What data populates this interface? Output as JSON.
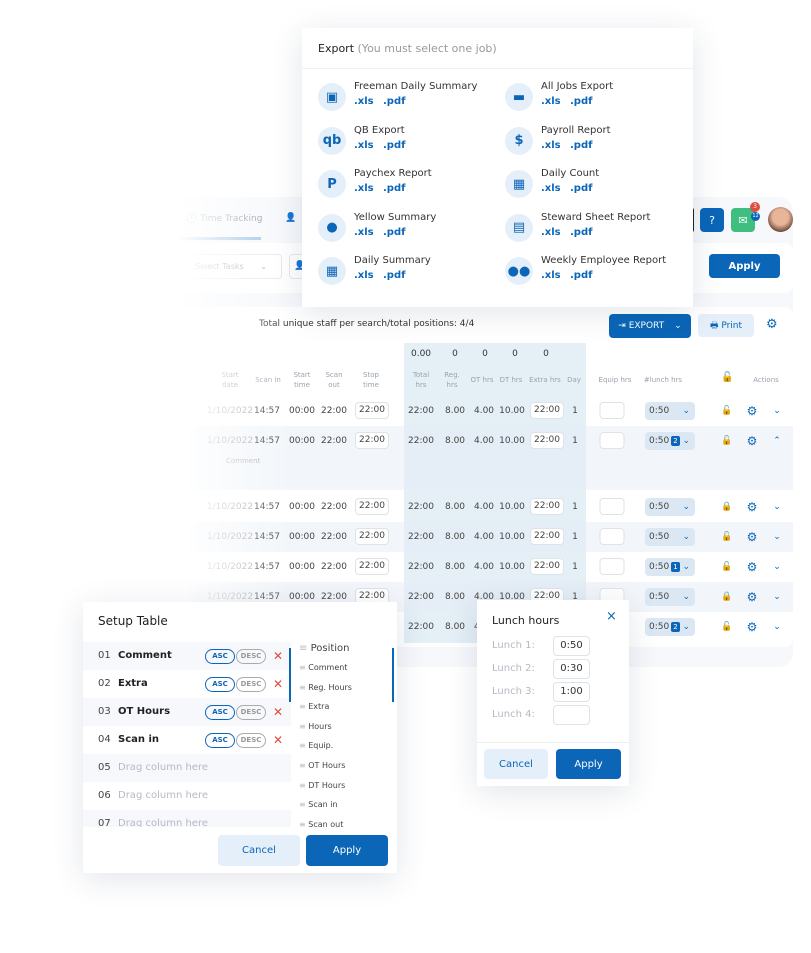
{
  "header": {
    "tabs": [
      {
        "label": "Time Tracking"
      }
    ],
    "notifications_badge": "3",
    "mail_badge": "12"
  },
  "filters": {
    "select_tasks_placeholder": "Select Tasks",
    "apply_label": "Apply"
  },
  "summary": {
    "text": "Total unique staff per search/total positions: 4/4",
    "export_label": "EXPORT",
    "print_label": "Print"
  },
  "totals": [
    "0.00",
    "0",
    "0",
    "0",
    "0"
  ],
  "columns": [
    "Start date",
    "Scan in",
    "Start time",
    "Scan out",
    "Stop time",
    "Total hrs",
    "Reg. hrs",
    "OT hrs",
    "DT hrs",
    "Extra hrs",
    "Day",
    "Equip hrs",
    "#lunch hrs",
    "Actions"
  ],
  "rows": [
    {
      "date": "1/10/2022",
      "scan_in": "14:57",
      "start": "00:00",
      "scan_out": "22:00",
      "stop": "22:00",
      "total": "22:00",
      "reg": "8.00",
      "ot": "4.00",
      "dt": "10.00",
      "extra": "22:00",
      "day": "1",
      "lunch": "0:50",
      "badge": "",
      "locked": false,
      "expanded": false
    },
    {
      "date": "1/10/2022",
      "scan_in": "14:57",
      "start": "00:00",
      "scan_out": "22:00",
      "stop": "22:00",
      "total": "22:00",
      "reg": "8.00",
      "ot": "4.00",
      "dt": "10.00",
      "extra": "22:00",
      "day": "1",
      "lunch": "0:50",
      "badge": "2",
      "locked": false,
      "expanded": true,
      "comment": "Comment"
    },
    {
      "date": "1/10/2022",
      "scan_in": "14:57",
      "start": "00:00",
      "scan_out": "22:00",
      "stop": "22:00",
      "total": "22:00",
      "reg": "8.00",
      "ot": "4.00",
      "dt": "10.00",
      "extra": "22:00",
      "day": "1",
      "lunch": "0:50",
      "badge": "",
      "locked": true,
      "expanded": false
    },
    {
      "date": "1/10/2022",
      "scan_in": "14:57",
      "start": "00:00",
      "scan_out": "22:00",
      "stop": "22:00",
      "total": "22:00",
      "reg": "8.00",
      "ot": "4.00",
      "dt": "10.00",
      "extra": "22:00",
      "day": "1",
      "lunch": "0:50",
      "badge": "",
      "locked": false,
      "expanded": false
    },
    {
      "date": "1/10/2022",
      "scan_in": "14:57",
      "start": "00:00",
      "scan_out": "22:00",
      "stop": "22:00",
      "total": "22:00",
      "reg": "8.00",
      "ot": "4.00",
      "dt": "10.00",
      "extra": "22:00",
      "day": "1",
      "lunch": "0:50",
      "badge": "1",
      "locked": false,
      "expanded": false
    },
    {
      "date": "1/10/2022",
      "scan_in": "14:57",
      "start": "00:00",
      "scan_out": "22:00",
      "stop": "22:00",
      "total": "22:00",
      "reg": "8.00",
      "ot": "4.00",
      "dt": "10.00",
      "extra": "22:00",
      "day": "1",
      "lunch": "0:50",
      "badge": "",
      "locked": true,
      "expanded": false
    },
    {
      "date": "",
      "scan_in": "",
      "start": "",
      "scan_out": "",
      "stop": "",
      "total": "22:00",
      "reg": "8.00",
      "ot": "4.00",
      "dt": "",
      "extra": "",
      "day": "",
      "lunch": "0:50",
      "badge": "2",
      "locked": false,
      "expanded": false
    }
  ],
  "export": {
    "title": "Export",
    "subtitle": "(You must select one job)",
    "xls": ".xls",
    "pdf": ".pdf",
    "items": [
      {
        "label": "Freeman Daily Summary",
        "icon": "clipboard-user-icon"
      },
      {
        "label": "All Jobs Export",
        "icon": "briefcase-icon"
      },
      {
        "label": "QB Export",
        "icon": "quickbooks-icon"
      },
      {
        "label": "Payroll Report",
        "icon": "dollar-file-icon"
      },
      {
        "label": "Paychex Report",
        "icon": "paychex-icon"
      },
      {
        "label": "Daily Count",
        "icon": "abacus-icon"
      },
      {
        "label": "Yellow Summary",
        "icon": "user-icon"
      },
      {
        "label": "Steward Sheet Report",
        "icon": "document-icon"
      },
      {
        "label": "Daily Summary",
        "icon": "calendar-icon"
      },
      {
        "label": "Weekly Employee Report",
        "icon": "users-icon"
      }
    ]
  },
  "setup": {
    "title": "Setup Table",
    "asc": "ASC",
    "desc": "DESC",
    "sorts": [
      {
        "num": "01",
        "name": "Comment"
      },
      {
        "num": "02",
        "name": "Extra"
      },
      {
        "num": "03",
        "name": "OT Hours"
      },
      {
        "num": "04",
        "name": "Scan in"
      }
    ],
    "placeholders": [
      {
        "num": "05",
        "text": "Drag column here"
      },
      {
        "num": "06",
        "text": "Drag column here"
      },
      {
        "num": "07",
        "text": "Drag column here"
      }
    ],
    "positions": [
      "Position",
      "Comment",
      "Reg. Hours",
      "Extra",
      "Hours",
      "Equip.",
      "OT Hours",
      "DT Hours",
      "Scan in",
      "Scan out"
    ],
    "cancel": "Cancel",
    "apply": "Apply"
  },
  "lunch": {
    "title": "Lunch hours",
    "items": [
      {
        "label": "Lunch 1:",
        "value": "0:50"
      },
      {
        "label": "Lunch 2:",
        "value": "0:30"
      },
      {
        "label": "Lunch 3:",
        "value": "1:00"
      },
      {
        "label": "Lunch 4:",
        "value": ""
      }
    ],
    "cancel": "Cancel",
    "apply": "Apply"
  },
  "colors": {
    "primary": "#0b66b8",
    "locked": "#e34b3c",
    "mail": "#3fbf7f"
  }
}
